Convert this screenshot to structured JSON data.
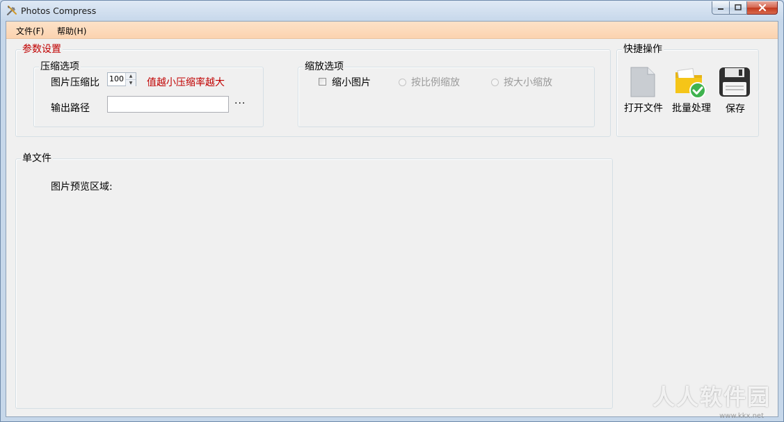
{
  "window": {
    "title": "Photos Compress",
    "caption_buttons": {
      "minimize_icon": "minimize-icon",
      "maximize_icon": "maximize-icon",
      "close_icon": "close-icon"
    }
  },
  "menu": [
    {
      "label": "文件(F)"
    },
    {
      "label": "帮助(H)"
    }
  ],
  "params": {
    "group_title": "参数设置",
    "compress": {
      "group_title": "压缩选项",
      "ratio_label": "图片压缩比",
      "ratio_value": "100",
      "hint": "值越小压缩率越大",
      "output_label": "输出路径",
      "output_value": "",
      "browse_label": "···"
    },
    "scale": {
      "group_title": "缩放选项",
      "shrink_label": "缩小图片",
      "shrink_checked": false,
      "by_ratio_label": "按比例缩放",
      "by_size_label": "按大小缩放"
    }
  },
  "quick_actions": {
    "group_title": "快捷操作",
    "items": [
      {
        "label": "打开文件",
        "icon": "file-icon"
      },
      {
        "label": "批量处理",
        "icon": "folder-check-icon"
      },
      {
        "label": "保存",
        "icon": "floppy-disk-icon"
      }
    ]
  },
  "single_file": {
    "group_title": "单文件",
    "preview_label": "图片预览区域:"
  },
  "watermark": {
    "text": "人人软件园",
    "sub": "www.kkx.net"
  },
  "colors": {
    "accent_red": "#c00000",
    "menu_bg": "#fcd9bb",
    "check_green": "#3fb34f",
    "folder_yellow": "#f5c518"
  }
}
